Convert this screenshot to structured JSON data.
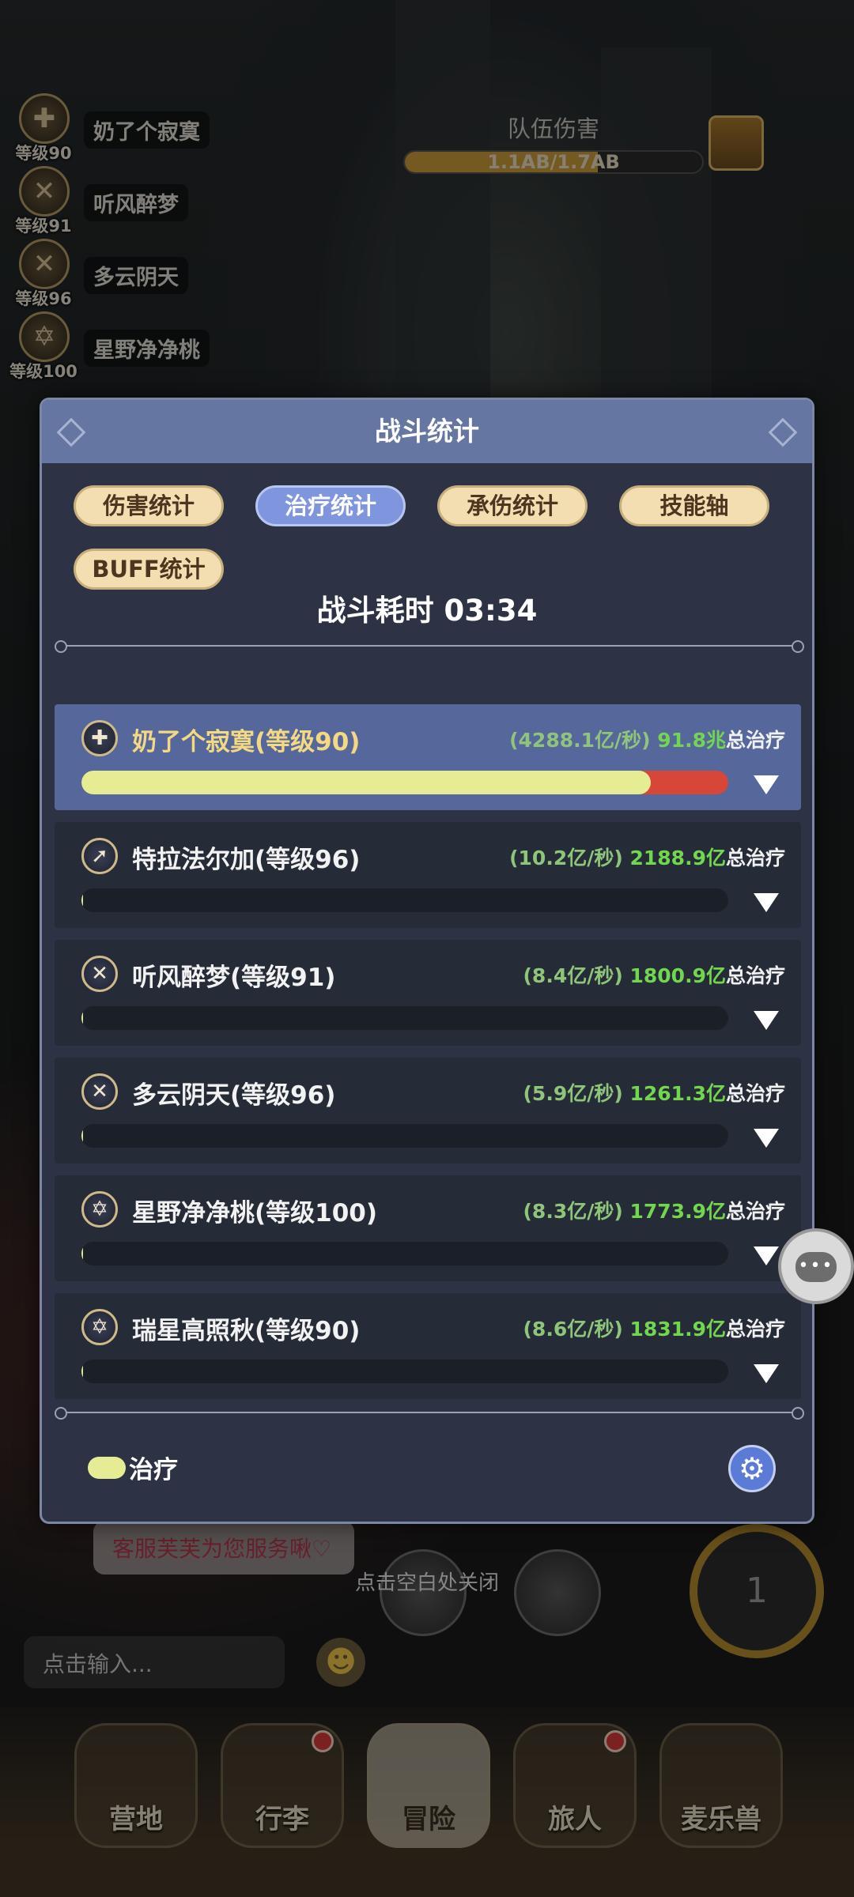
{
  "party": [
    {
      "name": "奶了个寂寞",
      "level": "等级90",
      "icon": "✚"
    },
    {
      "name": "听风醉梦",
      "level": "等级91",
      "icon": "✕"
    },
    {
      "name": "多云阴天",
      "level": "等级96",
      "icon": "✕"
    },
    {
      "name": "星野净净桃",
      "level": "等级100",
      "icon": "✡"
    }
  ],
  "team_damage": {
    "title": "队伍伤害",
    "value": "1.1AB/1.7AB",
    "progress": 0.65
  },
  "modal": {
    "title": "战斗统计",
    "tabs": [
      "伤害统计",
      "治疗统计",
      "承伤统计",
      "技能轴",
      "BUFF统计"
    ],
    "active_tab": "治疗统计",
    "duration": "战斗耗时  03:34",
    "total_label": "总治疗",
    "legend_label": "治疗",
    "rows": [
      {
        "name": "奶了个寂寞(等级90)",
        "rate": "(4288.1亿/秒)",
        "total": "91.8兆",
        "fill": 0.88,
        "icon": "✚"
      },
      {
        "name": "特拉法尔加(等级96)",
        "rate": "(10.2亿/秒)",
        "total": "2188.9亿",
        "fill": 0.002,
        "icon": "➚"
      },
      {
        "name": "听风醉梦(等级91)",
        "rate": "(8.4亿/秒)",
        "total": "1800.9亿",
        "fill": 0.002,
        "icon": "✕"
      },
      {
        "name": "多云阴天(等级96)",
        "rate": "(5.9亿/秒)",
        "total": "1261.3亿",
        "fill": 0.002,
        "icon": "✕"
      },
      {
        "name": "星野净净桃(等级100)",
        "rate": "(8.3亿/秒)",
        "total": "1773.9亿",
        "fill": 0.002,
        "icon": "✡"
      },
      {
        "name": "瑞星高照秋(等级90)",
        "rate": "(8.6亿/秒)",
        "total": "1831.9亿",
        "fill": 0.002,
        "icon": "✡"
      }
    ]
  },
  "chat": {
    "bubble": "客服芙芙为您服务啾♡",
    "input_placeholder": "点击输入..."
  },
  "close_hint": "点击空白处关闭",
  "nav": [
    {
      "label": "营地",
      "dot": false
    },
    {
      "label": "行李",
      "dot": true
    },
    {
      "label": "冒险",
      "dot": false,
      "active": true
    },
    {
      "label": "旅人",
      "dot": true
    },
    {
      "label": "麦乐兽",
      "dot": false
    }
  ],
  "colors": {
    "heal_fill": "#e6ec93",
    "overheal": "#d6473a",
    "header": "#6676a3",
    "tab_active": "#7f96df",
    "total": "#72d64f"
  }
}
